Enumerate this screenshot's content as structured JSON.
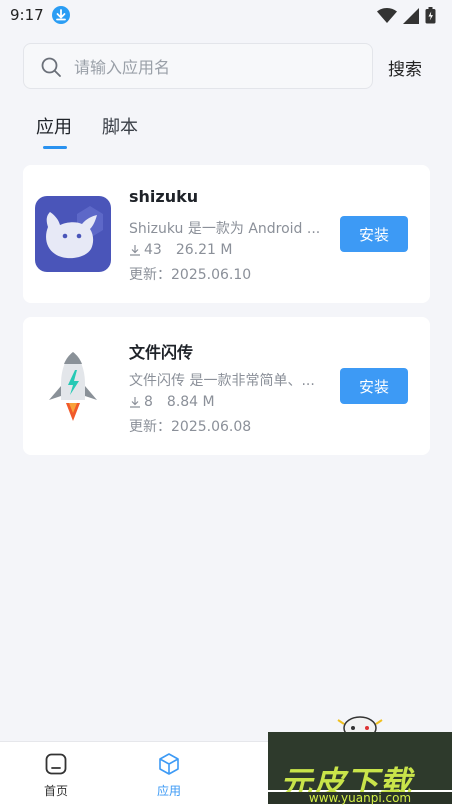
{
  "status_bar": {
    "time": "9:17"
  },
  "search": {
    "placeholder": "请输入应用名",
    "button_label": "搜索"
  },
  "tabs": [
    {
      "label": "应用",
      "active": true
    },
    {
      "label": "脚本",
      "active": false
    }
  ],
  "apps": [
    {
      "name": "shizuku",
      "description": "Shizuku 是一款为 Android ...",
      "downloads": "43",
      "size": "26.21 M",
      "updated_label": "更新：",
      "updated": "2025.06.10",
      "install_label": "安装",
      "icon": "shizuku-icon"
    },
    {
      "name": "文件闪传",
      "description": "文件闪传 是一款非常简单、...",
      "downloads": "8",
      "size": "8.84 M",
      "updated_label": "更新：",
      "updated": "2025.06.08",
      "install_label": "安装",
      "icon": "rocket-icon"
    }
  ],
  "bottom_nav": [
    {
      "label": "首页",
      "icon": "home-icon",
      "active": false
    },
    {
      "label": "应用",
      "icon": "cube-icon",
      "active": true
    }
  ],
  "watermark": {
    "text": "元皮下载",
    "url": "www.yuanpi.com"
  },
  "colors": {
    "accent": "#3d9af5",
    "background": "#f4f5f9",
    "card": "#ffffff",
    "muted_text": "#8b9099"
  }
}
